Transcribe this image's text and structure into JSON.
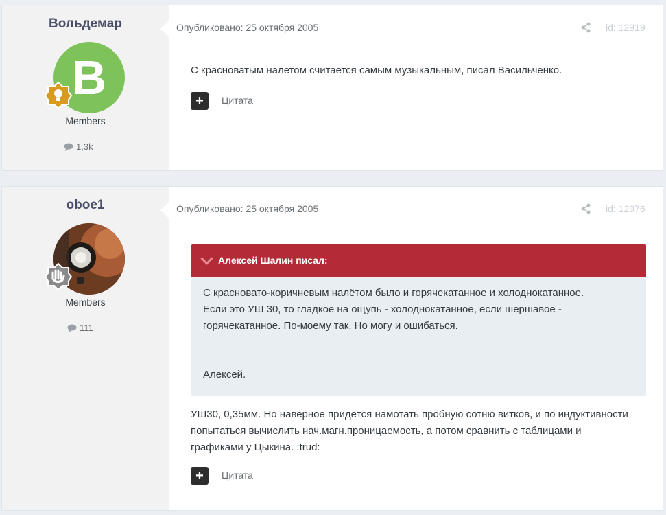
{
  "posts": [
    {
      "author": "Вольдемар",
      "avatar_letter": "В",
      "avatar_color": "#7ec25a",
      "badge_icon": "lightbulb-badge",
      "group": "Members",
      "post_count": "1,3k",
      "published": "Опубликовано: 25 октября 2005",
      "id": "id: 12919",
      "text": "С красноватым налетом считается самым музыкальным, писал Васильченко.",
      "quote_label": "Цитата"
    },
    {
      "author": "oboe1",
      "avatar_type": "photo",
      "badge_icon": "hand-wave-badge",
      "group": "Members",
      "post_count": "111",
      "published": "Опубликовано: 25 октября 2005",
      "id": "id: 12976",
      "quote": {
        "header": "Алексей Шалин писал:",
        "lines": [
          "С красновато-коричневым налётом было и горячекатанное и холоднокатанное.",
          "Если это УШ 30, то гладкое на ощупь - холоднокатанное, если шершавое -",
          "горячекатанное. По-моему так. Но могу и ошибаться."
        ],
        "signature": "Алексей."
      },
      "text_lines": [
        "УШ30, 0,35мм. Но наверное придётся намотать пробную сотню витков, и по индуктивности",
        "попытаться вычислить нач.магн.проницаемость, а потом сравнить с таблицами и",
        "графиками у Цыкина. :trud:"
      ],
      "quote_label": "Цитата"
    }
  ],
  "colors": {
    "quote_header": "#b32b37",
    "avatar_green": "#7ec25a",
    "badge_gold": "#d79b1f",
    "badge_grey": "#8a8a8a"
  }
}
